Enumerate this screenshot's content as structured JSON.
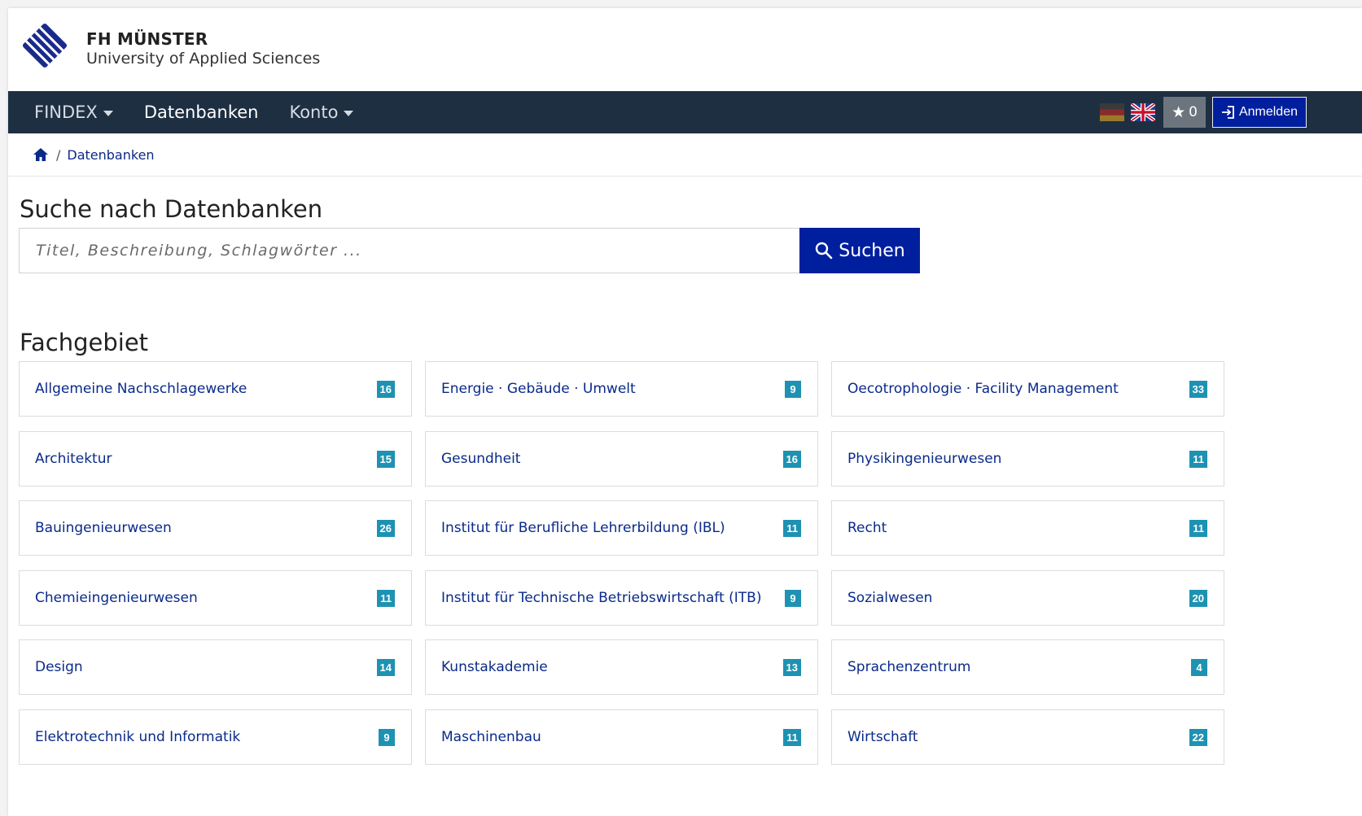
{
  "header": {
    "brand_name": "FH MÜNSTER",
    "brand_sub": "University of Applied Sciences"
  },
  "navbar": {
    "items": [
      {
        "label": "FINDEX",
        "dropdown": true
      },
      {
        "label": "Datenbanken",
        "dropdown": false,
        "active": true
      },
      {
        "label": "Konto",
        "dropdown": true
      }
    ],
    "flags": [
      "german-flag-icon",
      "uk-flag-icon"
    ],
    "favorites_count": "0",
    "login_label": "Anmelden"
  },
  "breadcrumb": {
    "current": "Datenbanken"
  },
  "search": {
    "title": "Suche nach Datenbanken",
    "placeholder": "Titel, Beschreibung, Schlagwörter ...",
    "button_label": "Suchen"
  },
  "fachgebiet": {
    "title": "Fachgebiet",
    "columns": [
      [
        {
          "label": "Allgemeine Nachschlagewerke",
          "count": "16"
        },
        {
          "label": "Architektur",
          "count": "15"
        },
        {
          "label": "Bauingenieurwesen",
          "count": "26"
        },
        {
          "label": "Chemieingenieurwesen",
          "count": "11"
        },
        {
          "label": "Design",
          "count": "14"
        },
        {
          "label": "Elektrotechnik und Informatik",
          "count": "9"
        }
      ],
      [
        {
          "label": "Energie · Gebäude · Umwelt",
          "count": "9"
        },
        {
          "label": "Gesundheit",
          "count": "16"
        },
        {
          "label": "Institut für Berufliche Lehrerbildung (IBL)",
          "count": "11"
        },
        {
          "label": "Institut für Technische Betriebswirtschaft (ITB)",
          "count": "9"
        },
        {
          "label": "Kunstakademie",
          "count": "13"
        },
        {
          "label": "Maschinenbau",
          "count": "11"
        }
      ],
      [
        {
          "label": "Oecotrophologie · Facility Management",
          "count": "33"
        },
        {
          "label": "Physikingenieurwesen",
          "count": "11"
        },
        {
          "label": "Recht",
          "count": "11"
        },
        {
          "label": "Sozialwesen",
          "count": "20"
        },
        {
          "label": "Sprachenzentrum",
          "count": "4"
        },
        {
          "label": "Wirtschaft",
          "count": "22"
        }
      ]
    ]
  },
  "colors": {
    "navbar_bg": "#1e2f42",
    "primary_button": "#001f9e",
    "link": "#0a2a8a",
    "badge": "#1e92b2",
    "favorites_button": "#6c757d"
  }
}
